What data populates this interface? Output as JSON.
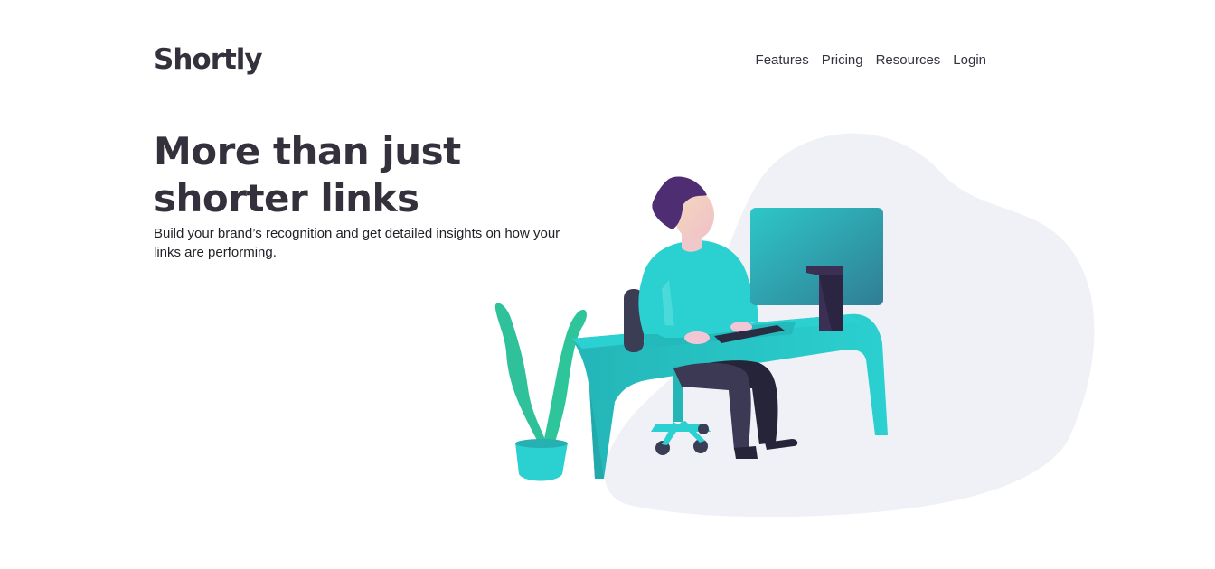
{
  "brand": {
    "logo": "Shortly"
  },
  "nav": {
    "items": [
      {
        "label": "Features"
      },
      {
        "label": "Pricing"
      },
      {
        "label": "Resources"
      },
      {
        "label": "Login"
      }
    ]
  },
  "hero": {
    "title": "More than just shorter links",
    "subtitle": "Build your brand’s recognition and get detailed insights on how your links are performing."
  },
  "colors": {
    "text_dark": "#34313d",
    "accent_cyan": "#2bd0d0",
    "blob_gray": "#f0f1f6",
    "dark_violet": "#3b3054"
  }
}
